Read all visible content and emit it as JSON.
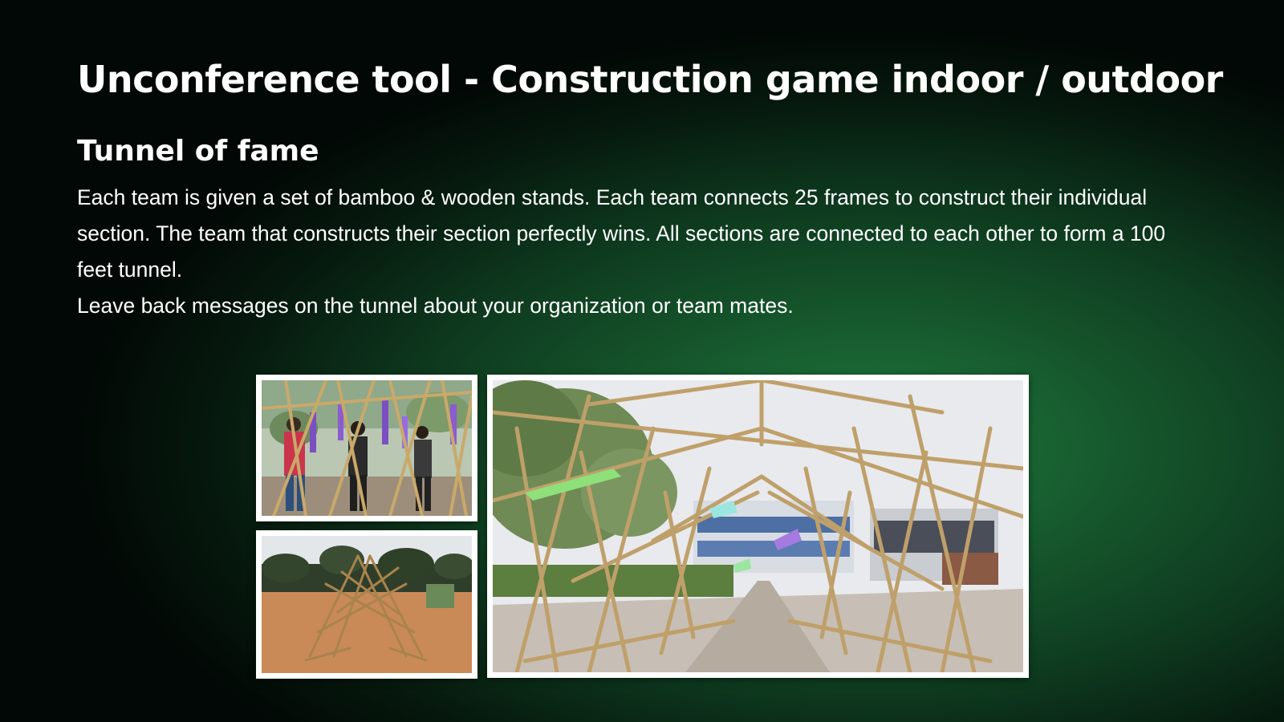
{
  "slide": {
    "title": "Unconference tool - Construction game indoor / outdoor",
    "heading": "Tunnel of fame",
    "paragraphs": [
      "Each team is given a set of bamboo & wooden stands. Each team connects 25 frames to construct their individual section. The team that constructs their section perfectly wins. All sections are connected to each other to form a 100 feet tunnel.",
      "Leave back messages on the tunnel about your organization or team mates."
    ]
  },
  "colors": {
    "background_center": "#1f7a3e",
    "background_edge": "#020805",
    "text": "#ffffff",
    "photo_border": "#ffffff"
  }
}
